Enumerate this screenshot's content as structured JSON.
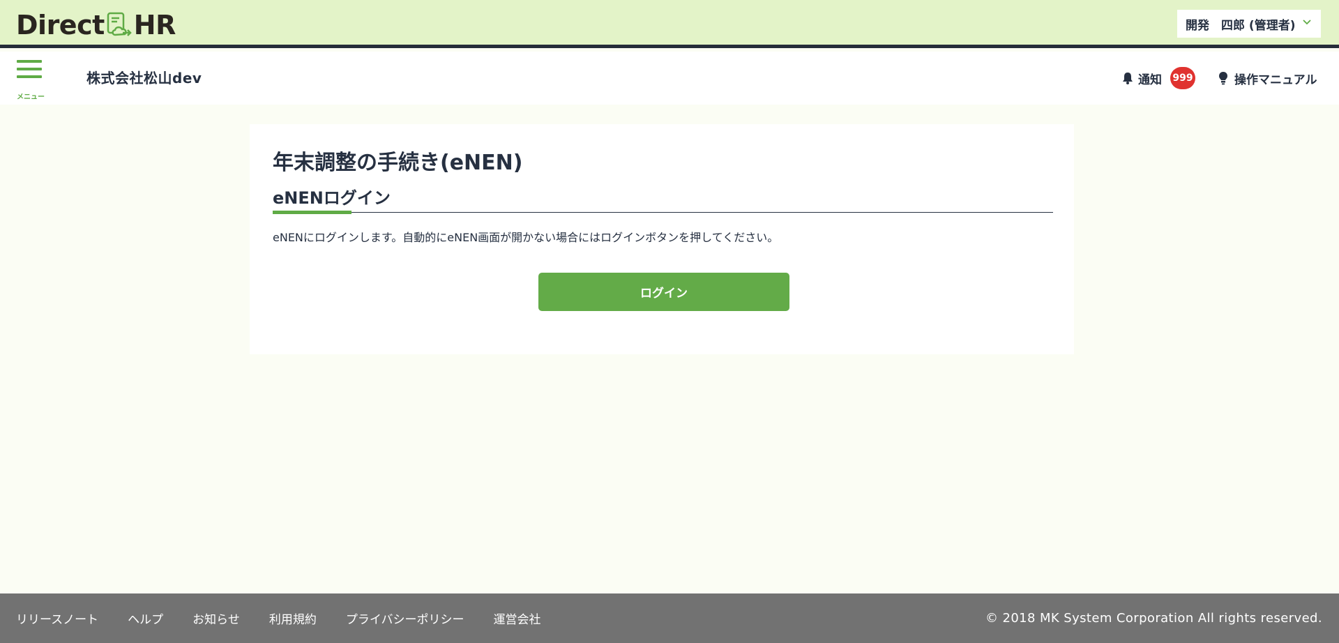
{
  "app": {
    "logo_left": "Direct",
    "logo_right": "HR",
    "brand_color": "#5fab45"
  },
  "user_menu": {
    "label": "開発　四郎 (管理者)",
    "icon": "chevron-down-icon"
  },
  "subheader": {
    "menu_label": "メニュー",
    "company": "株式会社松山dev",
    "notice_label": "通知",
    "notice_count": "999",
    "manual_label": "操作マニュアル"
  },
  "main": {
    "page_title": "年末調整の手続き(eNEN)",
    "section_title": "eNENログイン",
    "description": "eNENにログインします。自動的にeNEN画面が開かない場合にはログインボタンを押してください。",
    "login_button": "ログイン"
  },
  "footer": {
    "links": [
      "リリースノート",
      "ヘルプ",
      "お知らせ",
      "利用規約",
      "プライバシーポリシー",
      "運営会社"
    ],
    "copyright": "© 2018 MK System Corporation All rights reserved."
  }
}
